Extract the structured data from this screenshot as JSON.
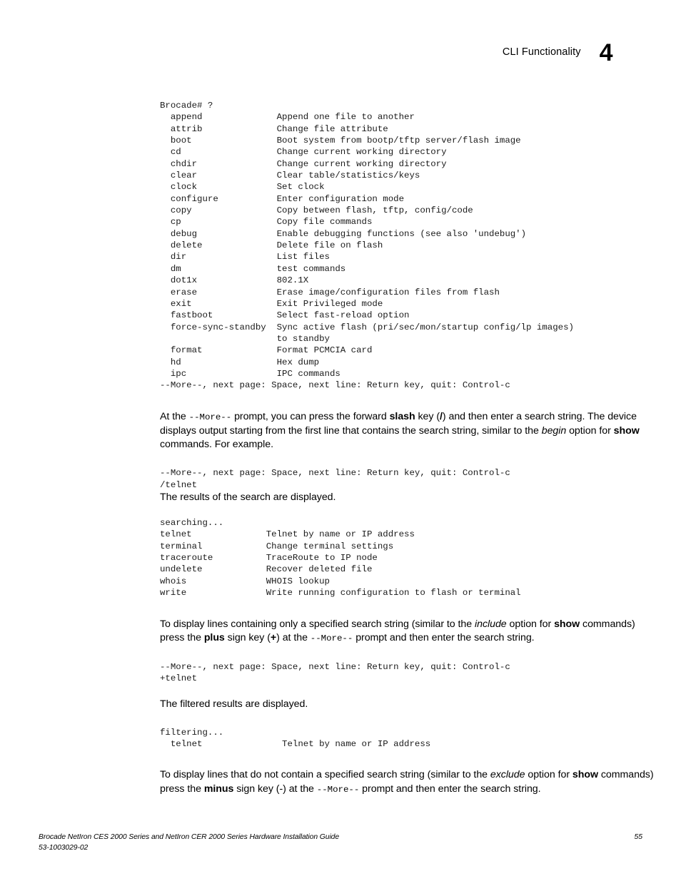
{
  "header": {
    "title": "CLI Functionality",
    "chapter_number": "4"
  },
  "code_blocks": {
    "help_output": "Brocade# ?\n  append              Append one file to another\n  attrib              Change file attribute\n  boot                Boot system from bootp/tftp server/flash image\n  cd                  Change current working directory\n  chdir               Change current working directory\n  clear               Clear table/statistics/keys\n  clock               Set clock\n  configure           Enter configuration mode\n  copy                Copy between flash, tftp, config/code\n  cp                  Copy file commands\n  debug               Enable debugging functions (see also 'undebug')\n  delete              Delete file on flash\n  dir                 List files\n  dm                  test commands\n  dot1x               802.1X\n  erase               Erase image/configuration files from flash\n  exit                Exit Privileged mode\n  fastboot            Select fast-reload option\n  force-sync-standby  Sync active flash (pri/sec/mon/startup config/lp images)\n                      to standby\n  format              Format PCMCIA card\n  hd                  Hex dump\n  ipc                 IPC commands\n--More--, next page: Space, next line: Return key, quit: Control-c",
    "slash_prompt": "--More--, next page: Space, next line: Return key, quit: Control-c\n/telnet",
    "search_results": "searching...\ntelnet              Telnet by name or IP address\nterminal            Change terminal settings\ntraceroute          TraceRoute to IP node\nundelete            Recover deleted file\nwhois               WHOIS lookup\nwrite               Write running configuration to flash or terminal",
    "plus_prompt": "--More--, next page: Space, next line: Return key, quit: Control-c\n+telnet",
    "filter_results": "filtering...\n  telnet               Telnet by name or IP address"
  },
  "paragraphs": {
    "slash_intro": {
      "p1": "At the ",
      "mono1": "--More--",
      "p2": " prompt, you can press the forward ",
      "b1": "slash",
      "p3": " key (",
      "b2": "/",
      "p4": ") and then enter a search string. The device displays output starting from the first line that contains the search string, similar to the ",
      "i1": "begin",
      "p5": " option for ",
      "b3": "show",
      "p6": " commands. For example."
    },
    "results_note": "The results of the search are displayed.",
    "plus_intro": {
      "p1": "To display lines containing only a specified search string (similar to the ",
      "i1": "include",
      "p2": " option for ",
      "b1": "show",
      "p3": " commands) press the ",
      "b2": "plus",
      "p4": " sign key (",
      "b3": "+",
      "p5": ") at the ",
      "mono1": "--More--",
      "p6": " prompt and then enter the search string."
    },
    "filtered_note": "The filtered results are displayed.",
    "minus_intro": {
      "p1": "To display lines that do not contain a specified search string (similar to the ",
      "i1": "exclude",
      "p2": " option for ",
      "b1": "show",
      "p3": " commands) press the ",
      "b2": "minus",
      "p4": " sign key (-) at the ",
      "mono1": "--More--",
      "p5": " prompt and then enter the search string."
    }
  },
  "footer": {
    "guide_title": "Brocade NetIron CES 2000 Series and NetIron CER 2000 Series Hardware Installation Guide",
    "doc_number": "53-1003029-02",
    "page_number": "55"
  }
}
